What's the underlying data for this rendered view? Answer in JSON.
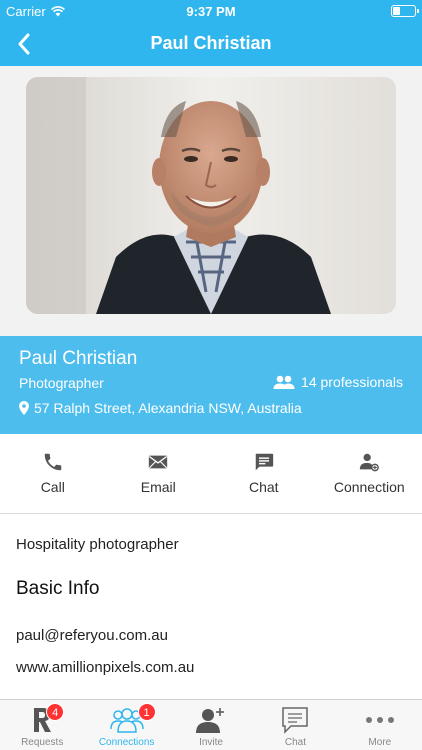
{
  "status_bar": {
    "carrier": "Carrier",
    "time": "9:37 PM"
  },
  "nav": {
    "title": "Paul Christian"
  },
  "profile": {
    "name": "Paul Christian",
    "profession": "Photographer",
    "professionals": "14 professionals",
    "address": "57 Ralph Street, Alexandria NSW, Australia"
  },
  "actions": [
    {
      "label": "Call",
      "icon": "phone-icon"
    },
    {
      "label": "Email",
      "icon": "envelope-icon"
    },
    {
      "label": "Chat",
      "icon": "chat-bubble-icon"
    },
    {
      "label": "Connection",
      "icon": "add-connection-icon"
    }
  ],
  "details": {
    "bio": "Hospitality photographer",
    "section_title": "Basic Info",
    "email": "paul@referyou.com.au",
    "website": "www.amillionpixels.com.au"
  },
  "tabs": [
    {
      "label": "Requests",
      "badge": "4",
      "icon": "referyou-logo-icon"
    },
    {
      "label": "Connections",
      "badge": "1",
      "icon": "group-icon"
    },
    {
      "label": "Invite",
      "icon": "invite-user-icon"
    },
    {
      "label": "Chat",
      "icon": "chat-icon"
    },
    {
      "label": "More",
      "icon": "more-dots-icon"
    }
  ],
  "colors": {
    "header": "#2fb6ee",
    "info_band": "#4dbdee",
    "badge": "#ff3333",
    "tab_active": "#2fb6ee"
  }
}
